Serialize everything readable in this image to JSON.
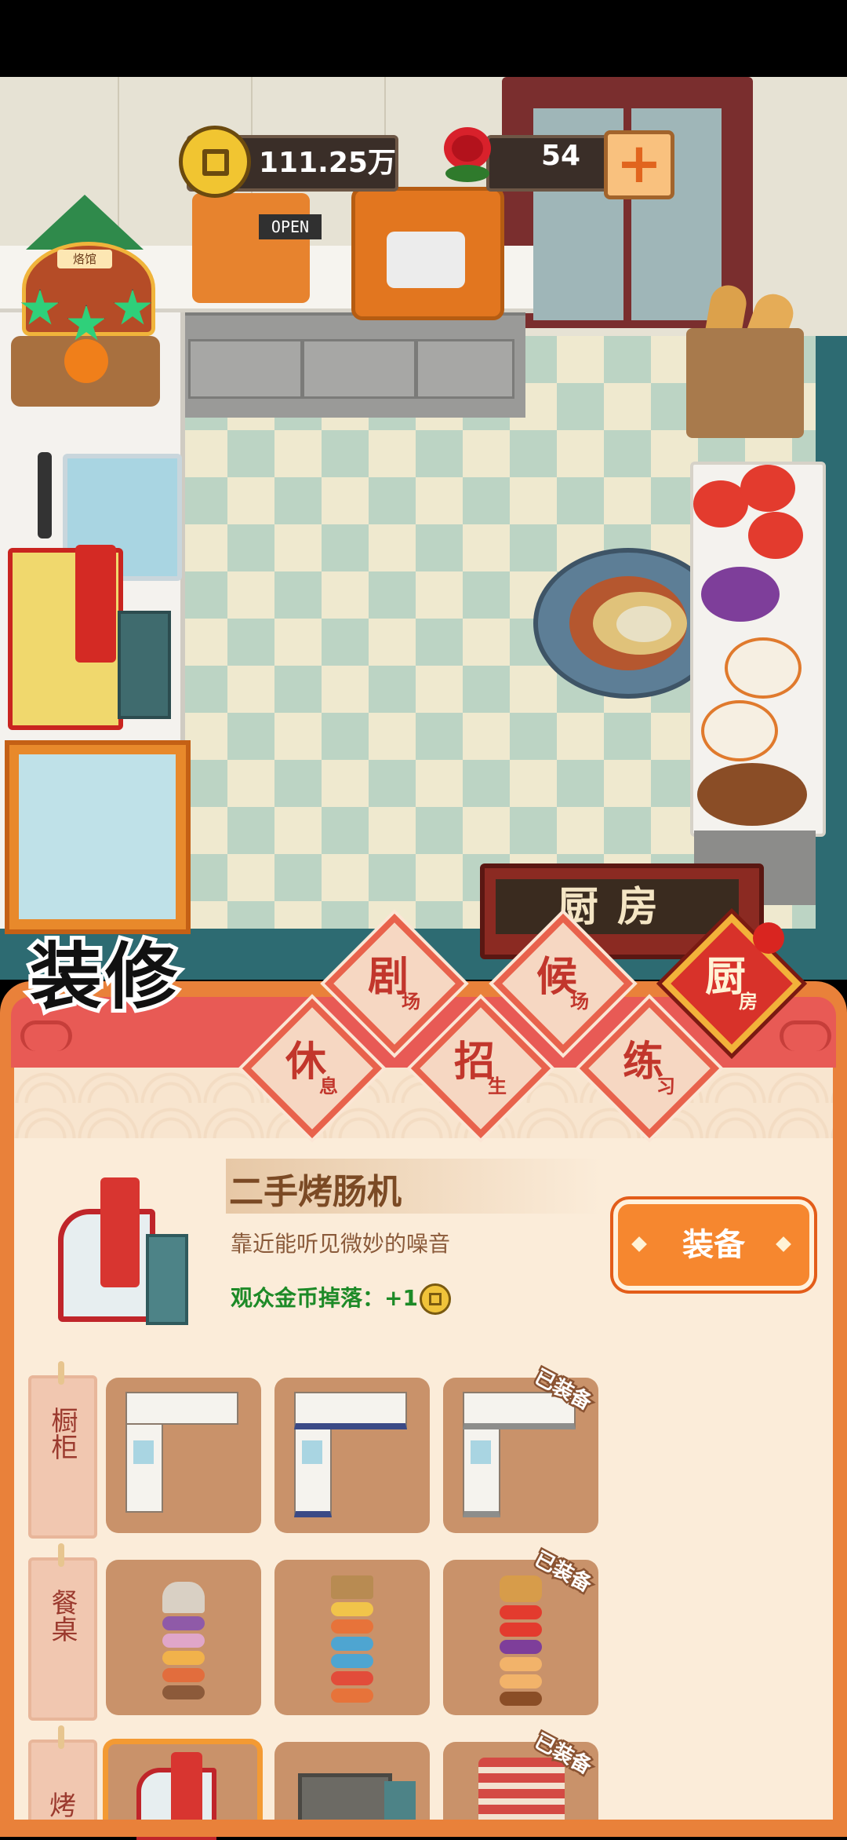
{
  "hud": {
    "coins": "111.25万",
    "roses": "54",
    "add_symbol": "+"
  },
  "scene": {
    "open_sign": "OPEN",
    "stall_sign": "烙馆",
    "kitchen_sign": "厨房",
    "stars": 3
  },
  "decorate_title": "装修",
  "tabs": [
    {
      "big": "剧",
      "small": "场",
      "active": false
    },
    {
      "big": "候",
      "small": "场",
      "active": false
    },
    {
      "big": "厨",
      "small": "房",
      "active": true
    },
    {
      "big": "休",
      "small": "息",
      "active": false
    },
    {
      "big": "招",
      "small": "生",
      "active": false
    },
    {
      "big": "练",
      "small": "习",
      "active": false
    }
  ],
  "selected_item": {
    "name": "二手烤肠机",
    "description": "靠近能听见微妙的噪音",
    "effect": "观众金币掉落：+1",
    "equip_label": "装备"
  },
  "categories": [
    {
      "label": "橱柜",
      "items": [
        {
          "equipped": false
        },
        {
          "equipped": false
        },
        {
          "equipped": true
        }
      ]
    },
    {
      "label": "餐桌",
      "items": [
        {
          "equipped": false
        },
        {
          "equipped": false
        },
        {
          "equipped": true
        }
      ]
    },
    {
      "label": "烤",
      "items": [
        {
          "equipped": false,
          "selected": true
        },
        {
          "equipped": false
        },
        {
          "equipped": true
        }
      ]
    }
  ],
  "equipped_label": "已装备",
  "colors": {
    "accent": "#e9813a",
    "header": "#e85a55",
    "active_tab": "#d8322a",
    "effect_green": "#1d8a27"
  }
}
